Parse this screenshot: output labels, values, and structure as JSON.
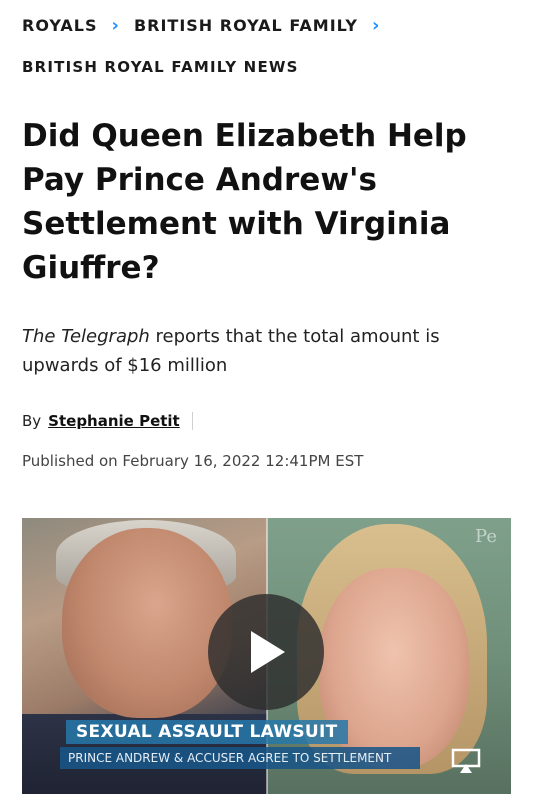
{
  "breadcrumb": {
    "items": [
      "ROYALS",
      "BRITISH ROYAL FAMILY"
    ],
    "separator_icon": "chevron-right-icon",
    "accent_color": "#1e90ff"
  },
  "section_label": "BRITISH ROYAL FAMILY NEWS",
  "article": {
    "title": "Did Queen Elizabeth Help Pay Prince Andrew's Settlement with Virginia Giuffre?",
    "dek_source": "The Telegraph",
    "dek_rest": " reports that the total amount is upwards of $16 million",
    "byline_prefix": "By",
    "author": "Stephanie Petit",
    "published": "Published on February 16, 2022 12:41PM EST"
  },
  "video": {
    "watermark": "Pe",
    "play_icon": "play-icon",
    "lower_third_title": "SEXUAL ASSAULT LAWSUIT",
    "lower_third_subtitle": "PRINCE ANDREW & ACCUSER AGREE TO SETTLEMENT",
    "cast_icon": "airplay-icon"
  }
}
